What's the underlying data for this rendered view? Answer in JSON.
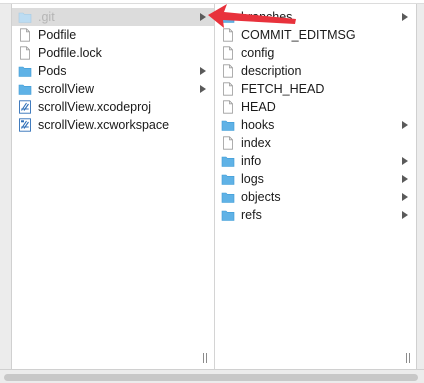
{
  "colors": {
    "folder": "#5fb2e6",
    "selection": "#dcdcdc",
    "arrow": "#e8323c"
  },
  "column1": {
    "items": [
      {
        "label": ".git",
        "icon": "folder-icon",
        "has_children": true,
        "selected": true
      },
      {
        "label": "Podfile",
        "icon": "document-icon",
        "has_children": false
      },
      {
        "label": "Podfile.lock",
        "icon": "document-icon",
        "has_children": false
      },
      {
        "label": "Pods",
        "icon": "folder-icon",
        "has_children": true
      },
      {
        "label": "scrollView",
        "icon": "folder-icon",
        "has_children": true
      },
      {
        "label": "scrollView.xcodeproj",
        "icon": "xcode-project-icon",
        "has_children": false
      },
      {
        "label": "scrollView.xcworkspace",
        "icon": "xcode-workspace-icon",
        "has_children": false
      }
    ]
  },
  "column2": {
    "items": [
      {
        "label": "branches",
        "icon": "folder-icon",
        "has_children": true
      },
      {
        "label": "COMMIT_EDITMSG",
        "icon": "document-icon",
        "has_children": false
      },
      {
        "label": "config",
        "icon": "document-icon",
        "has_children": false
      },
      {
        "label": "description",
        "icon": "document-icon",
        "has_children": false
      },
      {
        "label": "FETCH_HEAD",
        "icon": "document-icon",
        "has_children": false
      },
      {
        "label": "HEAD",
        "icon": "document-icon",
        "has_children": false
      },
      {
        "label": "hooks",
        "icon": "folder-icon",
        "has_children": true
      },
      {
        "label": "index",
        "icon": "document-icon",
        "has_children": false
      },
      {
        "label": "info",
        "icon": "folder-icon",
        "has_children": true
      },
      {
        "label": "logs",
        "icon": "folder-icon",
        "has_children": true
      },
      {
        "label": "objects",
        "icon": "folder-icon",
        "has_children": true
      },
      {
        "label": "refs",
        "icon": "folder-icon",
        "has_children": true
      }
    ]
  }
}
